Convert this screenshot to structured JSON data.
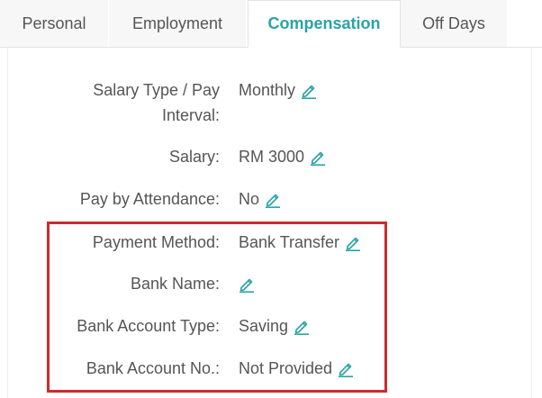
{
  "tabs": [
    {
      "label": "Personal"
    },
    {
      "label": "Employment"
    },
    {
      "label": "Compensation"
    },
    {
      "label": "Off Days"
    }
  ],
  "active_tab": "Compensation",
  "accent_color": "#2aa3a5",
  "highlight_color": "#cc2a2f",
  "fields": [
    {
      "label": "Salary Type / Pay Interval:",
      "label_line1": "Salary Type / Pay",
      "label_line2": "Interval:",
      "value": "Monthly",
      "icon": "pencil-edit-icon"
    },
    {
      "label": "Salary:",
      "value": "RM 3000",
      "icon": "pencil-edit-icon"
    },
    {
      "label": "Pay by Attendance:",
      "value": "No",
      "icon": "pencil-edit-icon"
    },
    {
      "label": "Payment Method:",
      "value": "Bank Transfer",
      "icon": "pencil-edit-icon"
    },
    {
      "label": "Bank Name:",
      "value": "",
      "icon": "pencil-edit-icon"
    },
    {
      "label": "Bank Account Type:",
      "value": "Saving",
      "icon": "pencil-edit-icon"
    },
    {
      "label": "Bank Account No.:",
      "value": "Not Provided",
      "icon": "pencil-edit-icon"
    }
  ]
}
